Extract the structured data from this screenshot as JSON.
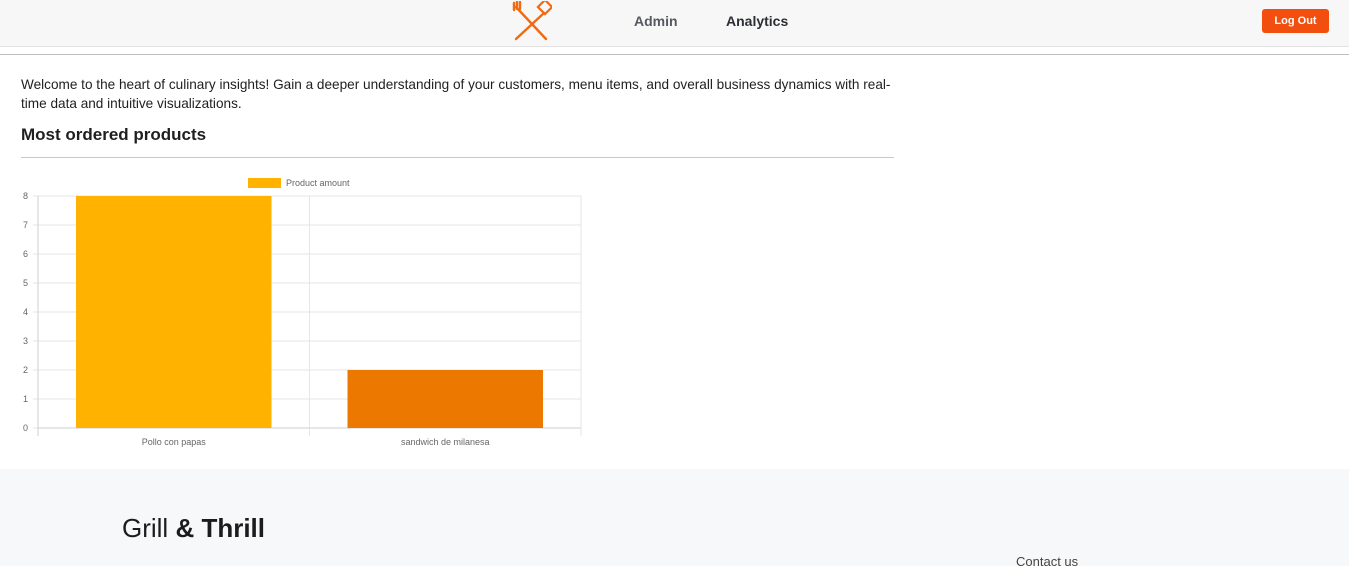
{
  "header": {
    "nav": [
      {
        "label": "Admin"
      },
      {
        "label": "Analytics"
      }
    ],
    "logout_label": "Log Out",
    "logo_icon": "crossed-fork-spatula-icon",
    "accent_color": "#f24f0e"
  },
  "main": {
    "intro": "Welcome to the heart of culinary insights! Gain a deeper understanding of your customers, menu items, and overall business dynamics with real-time data and intuitive visualizations.",
    "section_title": "Most ordered products"
  },
  "chart_data": {
    "type": "bar",
    "categories": [
      "Pollo con papas",
      "sandwich de milanesa"
    ],
    "series": [
      {
        "name": "Product amount",
        "values": [
          8,
          2
        ],
        "colors": [
          "#ffb200",
          "#ec7800"
        ]
      }
    ],
    "legend_color": "#ffb200",
    "ylim": [
      0,
      8
    ],
    "yticks": [
      0,
      1,
      2,
      3,
      4,
      5,
      6,
      7,
      8
    ],
    "grid": true,
    "legend_position": "top"
  },
  "footer": {
    "brand_light": "Grill",
    "brand_bold": "& Thrill",
    "contact_label": "Contact us"
  }
}
